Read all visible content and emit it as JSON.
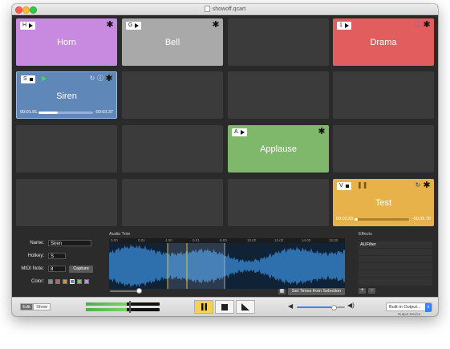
{
  "window": {
    "title": "showoff.qcart"
  },
  "cues": {
    "horn": {
      "name": "Horn",
      "hotkey": "H",
      "color": "#c88ae0"
    },
    "bell": {
      "name": "Bell",
      "hotkey": "G",
      "color": "#a9a9a9"
    },
    "drama": {
      "name": "Drama",
      "hotkey": "1",
      "color": "#e25e5e"
    },
    "siren": {
      "name": "Siren",
      "hotkey": "S",
      "color": "#5f88b8",
      "elapsed": "00:01.81",
      "remaining": "-00:03.37",
      "progress": 0.35
    },
    "applause": {
      "name": "Applause",
      "hotkey": "A",
      "color": "#7fb76b"
    },
    "test": {
      "name": "Test",
      "hotkey": "V",
      "color": "#e8b24a",
      "elapsed": "00:02.55",
      "remaining": "-00:39.78",
      "progress": 0.06
    }
  },
  "editor": {
    "name_label": "Name:",
    "name_value": "Siren",
    "hotkey_label": "Hotkey:",
    "hotkey_value": "S",
    "midi_label": "MIDI Note:",
    "midi_value": "8",
    "capture_label": "Capture",
    "color_label": "Color:",
    "swatches": [
      "#888888",
      "#c06060",
      "#d09050",
      "#5f88b8",
      "#7fb76b",
      "#c88ae0"
    ],
    "audio_trim_title": "Audio Trim",
    "ruler_ticks": [
      "0.00",
      "0.01",
      "4.00",
      "0.01",
      "8.00",
      "10.00",
      "12.00",
      "14.00",
      "16.00"
    ],
    "set_times_label": "Set Times from Selection",
    "effects_title": "Effects",
    "effects": [
      "AUFilter"
    ],
    "add_label": "+",
    "remove_label": "−"
  },
  "toolbar": {
    "edit_label": "Edit",
    "show_label": "Show",
    "meter_left_level": 0.55,
    "meter_right_level": 0.55,
    "volume_level": 0.78,
    "output_device_value": "Built-in Output...",
    "output_device_label": "Output Device"
  }
}
